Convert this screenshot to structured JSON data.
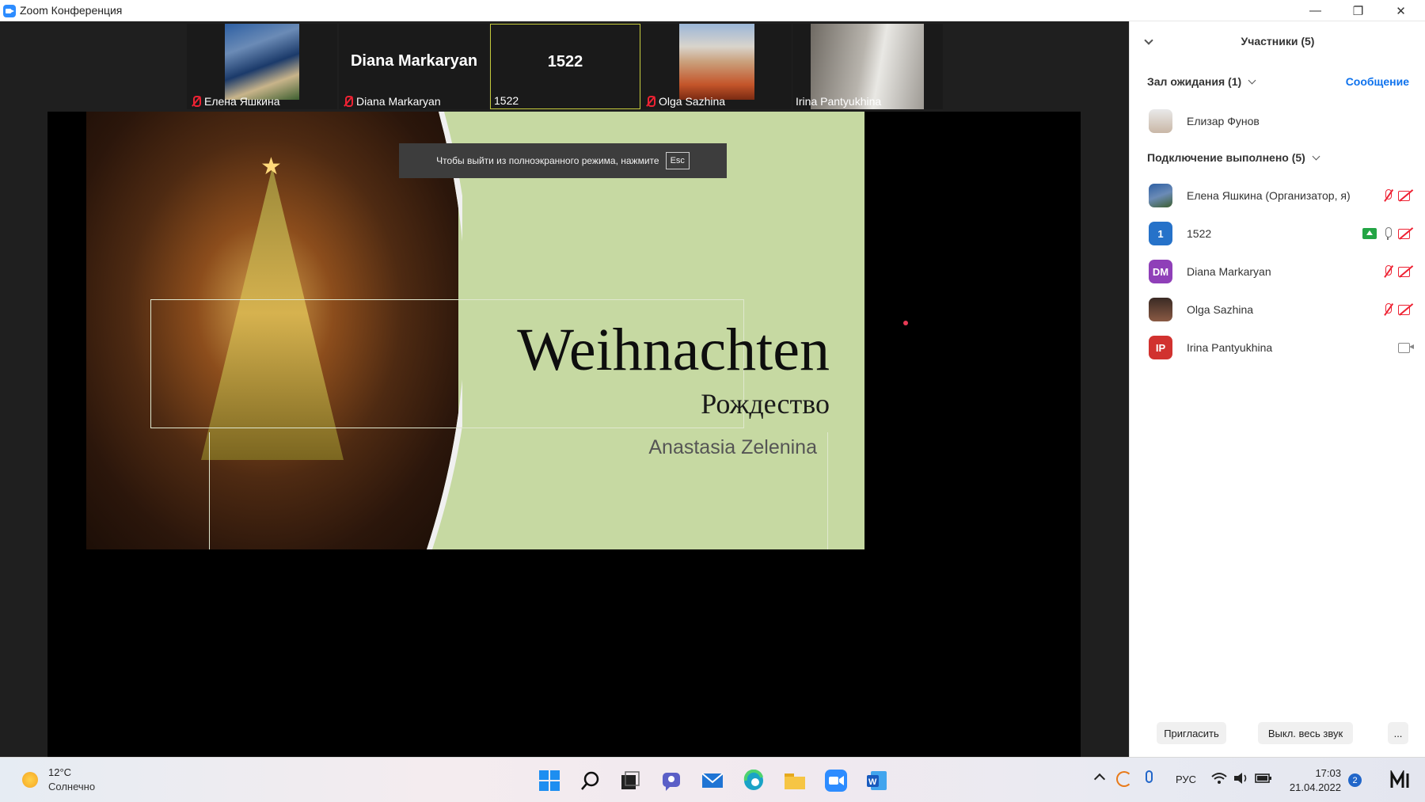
{
  "window": {
    "title": "Zoom Конференция"
  },
  "tiles": [
    {
      "name": "Елена Яшкина",
      "muted": true,
      "type": "video"
    },
    {
      "name": "Diana Markaryan",
      "center": "Diana Markaryan",
      "muted": true,
      "type": "name"
    },
    {
      "name": "1522",
      "center": "1522",
      "muted": false,
      "type": "name"
    },
    {
      "name": "Olga Sazhina",
      "muted": true,
      "type": "video"
    },
    {
      "name": "Irina Pantyukhina",
      "muted": false,
      "type": "video"
    }
  ],
  "slide": {
    "title": "Weihnachten",
    "subtitle": "Рождество",
    "author": "Anastasia Zelenina"
  },
  "fullscreen_notice": {
    "text": "Чтобы выйти из полноэкранного режима, нажмите",
    "key": "Esc"
  },
  "panel": {
    "header": "Участники (5)",
    "waiting_label": "Зал ожидания (1)",
    "message_link": "Сообщение",
    "waiting": [
      {
        "name": "Елизар Фунов"
      }
    ],
    "connected_label": "Подключение выполнено (5)",
    "participants": [
      {
        "name": "Елена Яшкина (Организатор, я)",
        "avatar": "",
        "color": "#3a5f8a",
        "mic": "off",
        "cam": "off"
      },
      {
        "name": "1522",
        "avatar": "1",
        "color": "#2672c9",
        "mic": "on",
        "cam": "off",
        "sharing": true
      },
      {
        "name": "Diana Markaryan",
        "avatar": "DM",
        "color": "#8f3fb8",
        "mic": "off",
        "cam": "off"
      },
      {
        "name": "Olga Sazhina",
        "avatar": "",
        "color": "#6d4b3e",
        "mic": "off",
        "cam": "off"
      },
      {
        "name": "Irina Pantyukhina",
        "avatar": "IP",
        "color": "#d1322f",
        "mic": "none",
        "cam": "on"
      }
    ],
    "invite_button": "Пригласить",
    "mute_all_button": "Выкл. весь звук",
    "more_button": "..."
  },
  "taskbar": {
    "weather_temp": "12°C",
    "weather_cond": "Солнечно",
    "lang": "РУС",
    "time": "17:03",
    "date": "21.04.2022",
    "notifications": "2",
    "icons": [
      "windows-start-icon",
      "search-icon",
      "task-view-icon",
      "chat-icon",
      "mail-icon",
      "edge-icon",
      "file-explorer-icon",
      "zoom-icon",
      "word-icon"
    ]
  }
}
